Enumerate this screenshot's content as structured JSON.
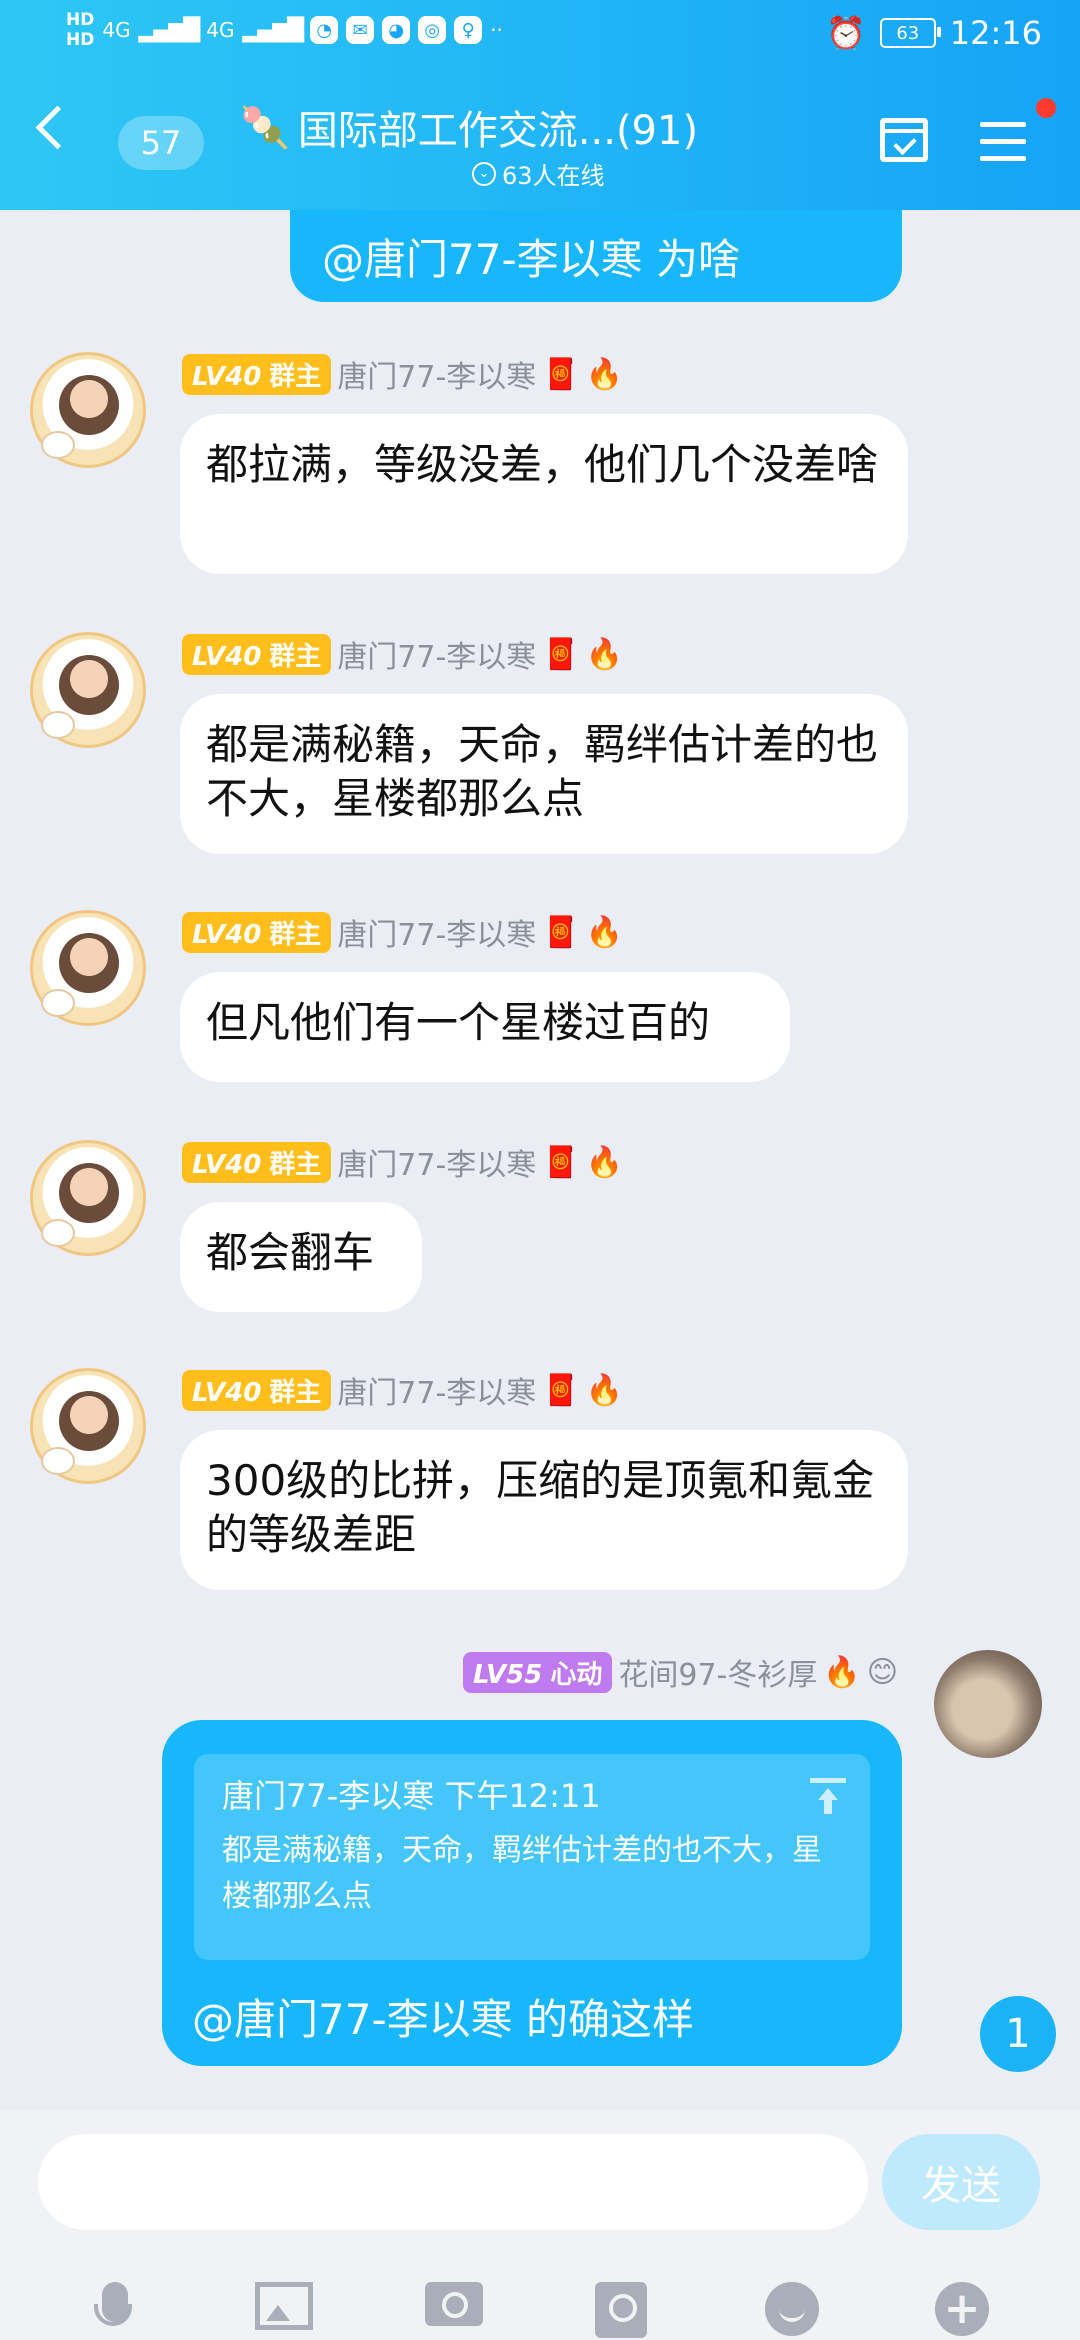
{
  "status": {
    "hd1": "HD",
    "hd2": "HD",
    "net1": "4G",
    "net2": "4G",
    "dots": "··",
    "battery": "63",
    "time": "12:16"
  },
  "header": {
    "unread_count": "57",
    "title": "国际部工作交流...(91)",
    "online": "63人在线"
  },
  "top_bubble": "@唐门77-李以寒 为啥",
  "messages": [
    {
      "level": "LV40",
      "role": "群主",
      "name": "唐门77-李以寒",
      "text": "都拉满，等级没差，他们几个没差啥"
    },
    {
      "level": "LV40",
      "role": "群主",
      "name": "唐门77-李以寒",
      "text": "都是满秘籍，天命，羁绊估计差的也不大，星楼都那么点"
    },
    {
      "level": "LV40",
      "role": "群主",
      "name": "唐门77-李以寒",
      "text": "但凡他们有一个星楼过百的"
    },
    {
      "level": "LV40",
      "role": "群主",
      "name": "唐门77-李以寒",
      "text": "都会翻车"
    },
    {
      "level": "LV40",
      "role": "群主",
      "name": "唐门77-李以寒",
      "text": "300级的比拼，压缩的是顶氪和氪金的等级差距"
    }
  ],
  "self_message": {
    "level": "LV55",
    "role": "心动",
    "name": "花间97-冬衫厚",
    "quote_name": "唐门77-李以寒 下午12:11",
    "quote_text": "都是满秘籍，天命，羁绊估计差的也不大，星楼都那么点",
    "text": "@唐门77-李以寒 的确这样"
  },
  "new_message_count": "1",
  "input": {
    "placeholder": "",
    "send_label": "发送"
  }
}
